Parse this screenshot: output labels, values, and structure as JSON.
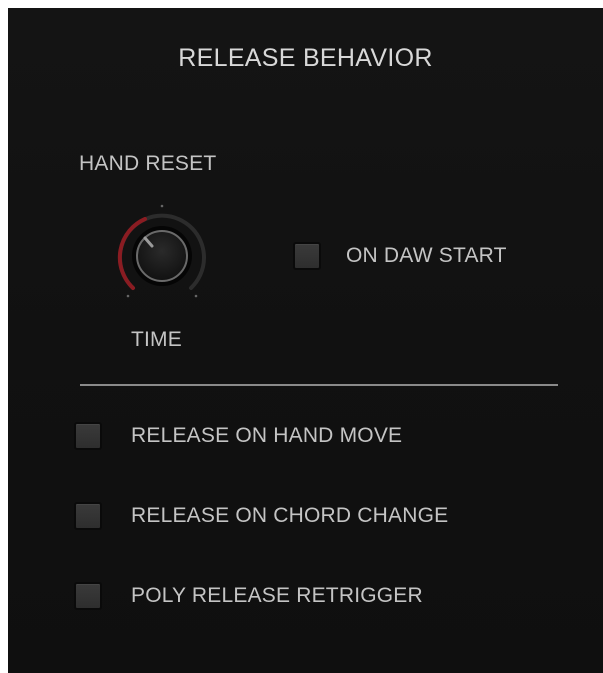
{
  "panel": {
    "title": "RELEASE BEHAVIOR"
  },
  "hand_reset": {
    "label": "HAND RESET",
    "knob_label": "TIME",
    "knob_icon": "rotary-knob-icon",
    "daw_checkbox_label": "ON DAW START",
    "daw_checked": false
  },
  "options": [
    {
      "label": "RELEASE ON HAND MOVE",
      "checked": false
    },
    {
      "label": "RELEASE ON CHORD CHANGE",
      "checked": false
    },
    {
      "label": "POLY RELEASE RETRIGGER",
      "checked": false
    }
  ],
  "colors": {
    "background": "#121212",
    "text": "#c4c4c4",
    "knob_accent": "#8a1c22",
    "divider": "#8a8a8a"
  }
}
